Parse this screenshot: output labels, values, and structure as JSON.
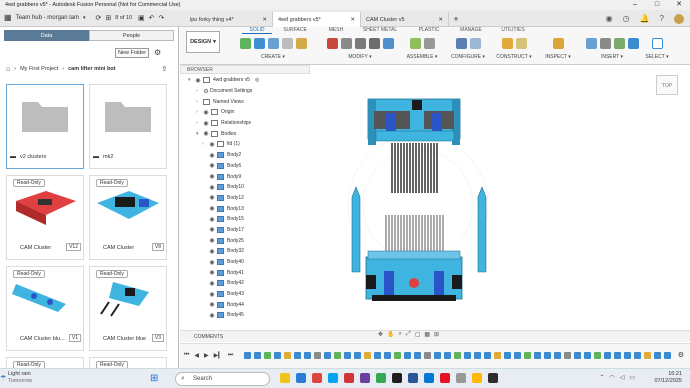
{
  "window": {
    "title": "4wd grabbers v5* - Autodesk Fusion Personal (Not for Commercial Use)",
    "controls": [
      "–",
      "□",
      "✕"
    ]
  },
  "topbar": {
    "team": "Team hub - morgan lam",
    "page_counter": "8 of 10"
  },
  "tabs": [
    {
      "label": "lpu forky thing v4*"
    },
    {
      "label": "4wd grabbers v5*"
    },
    {
      "label": "CAM Cluster v5"
    }
  ],
  "data_panel": {
    "tabs": [
      "Data",
      "People"
    ],
    "new_folder": "New Folder",
    "breadcrumb": [
      "My First Project",
      "cam lifter mini bot"
    ],
    "items": [
      {
        "name": "v2 clusters",
        "version": "",
        "badge": "",
        "kind": "folder"
      },
      {
        "name": "mk2",
        "version": "",
        "badge": "",
        "kind": "folder"
      },
      {
        "name": "CAM Cluster",
        "version": "V12",
        "badge": "Read-Only",
        "kind": "red"
      },
      {
        "name": "CAM Cluster",
        "version": "V8",
        "badge": "Read-Only",
        "kind": "cyan"
      },
      {
        "name": "CAM Cluster blu...",
        "version": "V1",
        "badge": "Read-Only",
        "kind": "blue1"
      },
      {
        "name": "CAM Cluster blue",
        "version": "V3",
        "badge": "Read-Only",
        "kind": "blue2"
      },
      {
        "name": "",
        "version": "",
        "badge": "Read-Only",
        "kind": "dark1"
      },
      {
        "name": "",
        "version": "",
        "badge": "Read-Only",
        "kind": "dark2"
      }
    ]
  },
  "toolbar": {
    "design": "DESIGN",
    "tabs": [
      "SOLID",
      "SURFACE",
      "MESH",
      "SHEET METAL",
      "PLASTIC",
      "MANAGE",
      "UTILITIES"
    ],
    "groups": [
      "CREATE",
      "MODIFY",
      "ASSEMBLE",
      "CONFIGURE",
      "CONSTRUCT",
      "INSPECT",
      "INSERT",
      "SELECT"
    ]
  },
  "browser": {
    "header": "BROWSER",
    "root": "4wd grabbers v5",
    "nodes": [
      "Document Settings",
      "Named Views",
      "Origin",
      "Relationships",
      "Bodies"
    ],
    "bodies": [
      "ltd (1)",
      "Body2",
      "Body6",
      "Body9",
      "Body10",
      "Body12",
      "Body13",
      "Body15",
      "Body17",
      "Body25",
      "Body32",
      "Body40",
      "Body41",
      "Body42",
      "Body43",
      "Body44",
      "Body45"
    ]
  },
  "viewcube": "TOP",
  "comments": "COMMENTS",
  "taskbar": {
    "weather_title": "Light rain",
    "weather_sub": "Tomorrow",
    "search": "Search",
    "time": "16:21",
    "date": "07/12/2025"
  },
  "colors": {
    "accent": "#1b6fb8",
    "model_cyan": "#3fb4e0",
    "model_dark": "#1a1a1a",
    "model_blue": "#2a55c8"
  }
}
